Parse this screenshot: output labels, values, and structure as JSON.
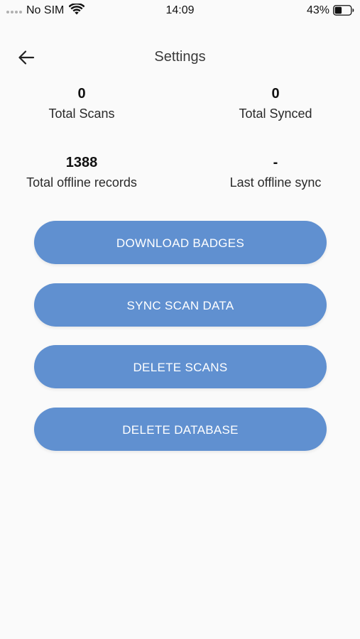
{
  "status_bar": {
    "carrier": "No SIM",
    "time": "14:09",
    "battery_percent": "43%"
  },
  "header": {
    "title": "Settings",
    "back_icon": "arrow-left-icon"
  },
  "stats": {
    "total_scans": {
      "value": "0",
      "label": "Total Scans"
    },
    "total_synced": {
      "value": "0",
      "label": "Total Synced"
    },
    "total_offline_records": {
      "value": "1388",
      "label": "Total offline records"
    },
    "last_offline_sync": {
      "value": "-",
      "label": "Last offline sync"
    }
  },
  "actions": {
    "download_badges": "DOWNLOAD BADGES",
    "sync_scan_data": "SYNC SCAN DATA",
    "delete_scans": "DELETE SCANS",
    "delete_database": "DELETE DATABASE"
  },
  "colors": {
    "button_background": "#6090d0",
    "button_text": "#ffffff",
    "page_background": "#fafafa"
  }
}
